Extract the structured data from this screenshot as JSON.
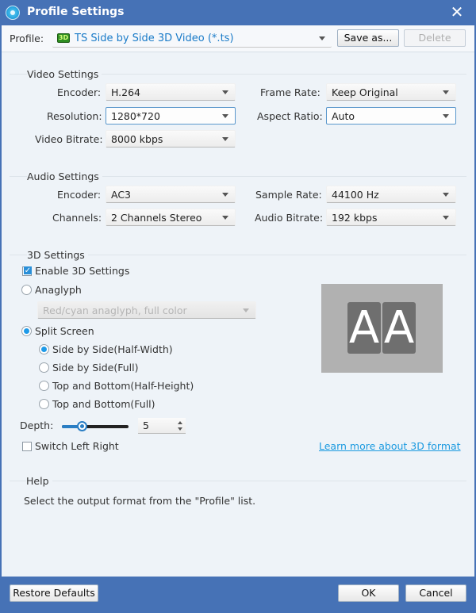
{
  "window": {
    "title": "Profile Settings",
    "close_glyph": "✕"
  },
  "profile": {
    "label": "Profile:",
    "badge": "3D",
    "value": "TS Side by Side 3D Video (*.ts)",
    "save_as_label": "Save as...",
    "delete_label": "Delete"
  },
  "video": {
    "section_title": "Video Settings",
    "encoder_label": "Encoder:",
    "encoder_value": "H.264",
    "resolution_label": "Resolution:",
    "resolution_value": "1280*720",
    "bitrate_label": "Video Bitrate:",
    "bitrate_value": "8000 kbps",
    "frame_rate_label": "Frame Rate:",
    "frame_rate_value": "Keep Original",
    "aspect_ratio_label": "Aspect Ratio:",
    "aspect_ratio_value": "Auto"
  },
  "audio": {
    "section_title": "Audio Settings",
    "encoder_label": "Encoder:",
    "encoder_value": "AC3",
    "channels_label": "Channels:",
    "channels_value": "2 Channels Stereo",
    "sample_rate_label": "Sample Rate:",
    "sample_rate_value": "44100 Hz",
    "bitrate_label": "Audio Bitrate:",
    "bitrate_value": "192 kbps"
  },
  "three_d": {
    "section_title": "3D Settings",
    "enable_label": "Enable 3D Settings",
    "enable_checked": true,
    "anaglyph_label": "Anaglyph",
    "anaglyph_value": "Red/cyan anaglyph, full color",
    "split_screen_label": "Split Screen",
    "split_options": [
      {
        "label": "Side by Side(Half-Width)",
        "selected": true
      },
      {
        "label": "Side by Side(Full)",
        "selected": false
      },
      {
        "label": "Top and Bottom(Half-Height)",
        "selected": false
      },
      {
        "label": "Top and Bottom(Full)",
        "selected": false
      }
    ],
    "depth_label": "Depth:",
    "depth_value": "5",
    "depth_slider_fraction": 0.3,
    "switch_label": "Switch Left Right",
    "switch_checked": false,
    "preview_left": "A",
    "preview_right": "A",
    "learn_more": "Learn more about 3D format"
  },
  "help": {
    "section_title": "Help",
    "text": "Select the output format from the \"Profile\" list."
  },
  "footer": {
    "restore_label": "Restore Defaults",
    "ok_label": "OK",
    "cancel_label": "Cancel"
  }
}
